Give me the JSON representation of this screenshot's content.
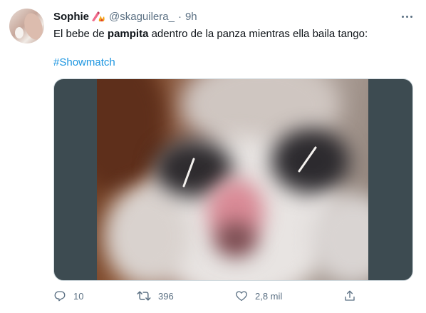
{
  "tweet": {
    "author_name": "Sophie",
    "author_emoji_icon": "nail-polish-fire-icon",
    "handle": "@skaguilera_",
    "separator": "·",
    "time": "9h",
    "text_before": "El bebe de ",
    "text_bold": "pampita",
    "text_after": " adentro de la panza mientras ella baila tango:",
    "hashtag": "#Showmatch"
  },
  "actions": {
    "reply_count": "10",
    "retweet_count": "396",
    "like_count": "2,8 mil"
  },
  "icons": {
    "reply": "reply-icon",
    "retweet": "retweet-icon",
    "like": "heart-icon",
    "share": "share-icon",
    "more": "more-options-icon"
  },
  "colors": {
    "text": "#0f1419",
    "secondary": "#5b7083",
    "link": "#1b95e0",
    "media_background": "#3d4b51"
  }
}
